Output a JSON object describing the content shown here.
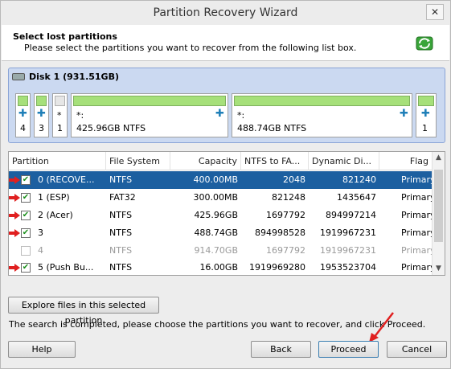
{
  "window": {
    "title": "Partition Recovery Wizard",
    "close_glyph": "✕"
  },
  "header": {
    "heading": "Select lost partitions",
    "instruction": "Please select the partitions you want to recover from the following list box."
  },
  "disk": {
    "title": "Disk 1 (931.51GB)",
    "partitions": [
      {
        "label": "4",
        "star": ""
      },
      {
        "label": "3",
        "star": ""
      },
      {
        "label": "1",
        "star": "*"
      },
      {
        "label": "425.96GB NTFS",
        "star": "*:"
      },
      {
        "label": "488.74GB NTFS",
        "star": "*:"
      },
      {
        "label": "1",
        "star": ""
      }
    ]
  },
  "table": {
    "headers": [
      "Partition",
      "File System",
      "Capacity",
      "NTFS to FA...",
      "Dynamic Di...",
      "Flag"
    ],
    "rows": [
      {
        "checked": true,
        "partition": "0 (RECOVE...",
        "fs": "NTFS",
        "capacity": "400.00MB",
        "ntfs_fat": "2048",
        "dynamic": "821240",
        "flag": "Primary"
      },
      {
        "checked": true,
        "partition": "1 (ESP)",
        "fs": "FAT32",
        "capacity": "300.00MB",
        "ntfs_fat": "821248",
        "dynamic": "1435647",
        "flag": "Primary"
      },
      {
        "checked": true,
        "partition": "2 (Acer)",
        "fs": "NTFS",
        "capacity": "425.96GB",
        "ntfs_fat": "1697792",
        "dynamic": "894997214",
        "flag": "Primary"
      },
      {
        "checked": true,
        "partition": "3",
        "fs": "NTFS",
        "capacity": "488.74GB",
        "ntfs_fat": "894998528",
        "dynamic": "1919967231",
        "flag": "Primary"
      },
      {
        "checked": false,
        "partition": "4",
        "fs": "NTFS",
        "capacity": "914.70GB",
        "ntfs_fat": "1697792",
        "dynamic": "1919967231",
        "flag": "Primary"
      },
      {
        "checked": true,
        "partition": "5 (Push Bu...",
        "fs": "NTFS",
        "capacity": "16.00GB",
        "ntfs_fat": "1919969280",
        "dynamic": "1953523704",
        "flag": "Primary"
      }
    ]
  },
  "buttons": {
    "explore": "Explore files in this selected partition",
    "help": "Help",
    "back": "Back",
    "proceed": "Proceed",
    "cancel": "Cancel"
  },
  "status": "The search is completed, please choose the partitions you want to recover, and click Proceed.",
  "icons": {
    "wizard": "recycle-arrows-icon",
    "disk": "hard-disk-icon",
    "plus": "plus-icon"
  },
  "colors": {
    "selection": "#1c5fa0",
    "used_bar": "#a6e07a",
    "disk_panel": "#cbd9f1",
    "annotation_arrow": "#e02020"
  }
}
